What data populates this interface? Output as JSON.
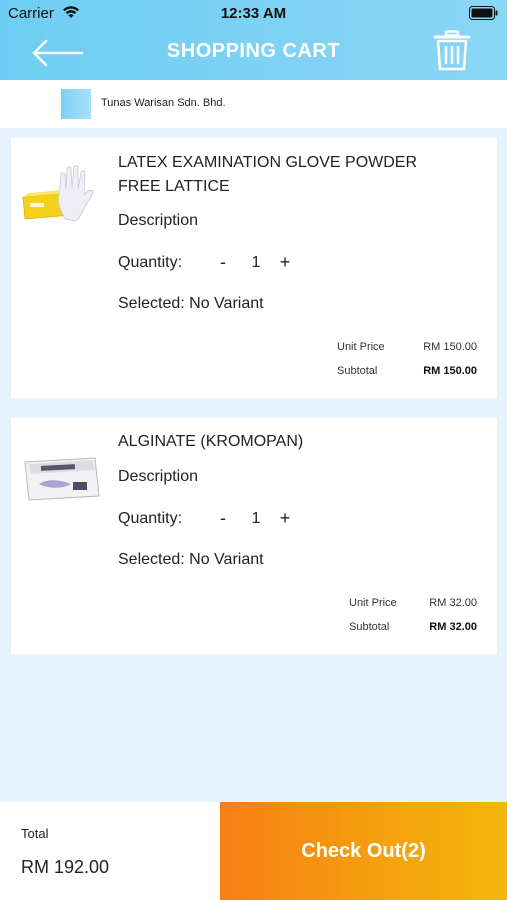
{
  "status_bar": {
    "carrier": "Carrier",
    "time": "12:33 AM"
  },
  "header": {
    "title": "SHOPPING CART",
    "back_icon": "arrow-left-icon",
    "trash_icon": "trash-icon",
    "gradient_start": "#6fcdf3",
    "gradient_end": "#8ad6f6"
  },
  "store": {
    "name": "Tunas Warisan Sdn. Bhd."
  },
  "cart_items": [
    {
      "name": "LATEX EXAMINATION GLOVE POWDER FREE LATTICE",
      "description": "Description",
      "quantity_label": "Quantity:",
      "quantity_minus": "-",
      "quantity": "1",
      "quantity_plus": "+",
      "variant": "Selected: No Variant",
      "unit_price_label": "Unit Price",
      "unit_price": "RM 150.00",
      "subtotal_label": "Subtotal",
      "subtotal": "RM 150.00"
    },
    {
      "name": "ALGINATE (KROMOPAN)",
      "description": "Description",
      "quantity_label": "Quantity:",
      "quantity_minus": "-",
      "quantity": "1",
      "quantity_plus": "+",
      "variant": "Selected: No Variant",
      "unit_price_label": "Unit Price",
      "unit_price": "RM 32.00",
      "subtotal_label": "Subtotal",
      "subtotal": "RM 32.00"
    }
  ],
  "footer": {
    "total_label": "Total",
    "total_value": "RM 192.00",
    "checkout_label": "Check Out(2)",
    "checkout_color": "#f58a14"
  }
}
